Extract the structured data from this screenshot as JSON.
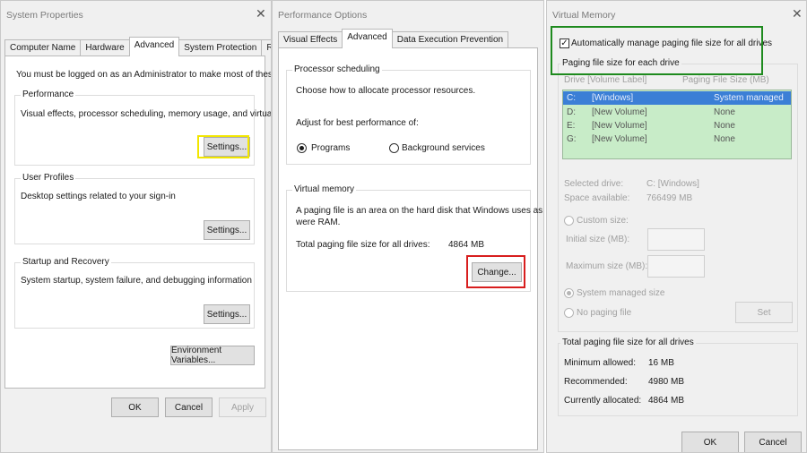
{
  "system_properties": {
    "title": "System Properties",
    "close_glyph": "✕",
    "tabs": [
      "Computer Name",
      "Hardware",
      "Advanced",
      "System Protection",
      "Remote"
    ],
    "admin_note": "You must be logged on as an Administrator to make most of these changes.",
    "performance": {
      "title": "Performance",
      "desc": "Visual effects, processor scheduling, memory usage, and virtual memory",
      "button": "Settings..."
    },
    "user_profiles": {
      "title": "User Profiles",
      "desc": "Desktop settings related to your sign-in",
      "button": "Settings..."
    },
    "startup": {
      "title": "Startup and Recovery",
      "desc": "System startup, system failure, and debugging information",
      "button": "Settings..."
    },
    "env_button": "Environment Variables...",
    "ok": "OK",
    "cancel": "Cancel",
    "apply": "Apply"
  },
  "performance_options": {
    "title": "Performance Options",
    "tabs": [
      "Visual Effects",
      "Advanced",
      "Data Execution Prevention"
    ],
    "processor": {
      "title": "Processor scheduling",
      "desc": "Choose how to allocate processor resources.",
      "adjust": "Adjust for best performance of:",
      "programs": "Programs",
      "background": "Background services",
      "selected": "programs"
    },
    "virtual_memory": {
      "title": "Virtual memory",
      "desc_line1": "A paging file is an area on the hard disk that Windows uses as if it",
      "desc_line2": "were RAM.",
      "total_label": "Total paging file size for all drives:",
      "total_value": "4864 MB",
      "change_button": "Change..."
    }
  },
  "virtual_memory": {
    "title": "Virtual Memory",
    "close_glyph": "✕",
    "auto_manage": "Automatically manage paging file size for all drives",
    "auto_checked": true,
    "paging_title": "Paging file size for each drive",
    "col_drive": "Drive  [Volume Label]",
    "col_size": "Paging File Size (MB)",
    "drives": [
      {
        "drive": "C:",
        "label": "[Windows]",
        "size": "System managed"
      },
      {
        "drive": "D:",
        "label": "[New Volume]",
        "size": "None"
      },
      {
        "drive": "E:",
        "label": "[New Volume]",
        "size": "None"
      },
      {
        "drive": "G:",
        "label": "[New Volume]",
        "size": "None"
      }
    ],
    "selected_drive_label": "Selected drive:",
    "selected_drive_value": "C:  [Windows]",
    "space_label": "Space available:",
    "space_value": "766499 MB",
    "custom_size": "Custom size:",
    "initial_label": "Initial size (MB):",
    "max_label": "Maximum size (MB):",
    "system_managed": "System managed size",
    "no_paging": "No paging file",
    "set_button": "Set",
    "totals_title": "Total paging file size for all drives",
    "min_label": "Minimum allowed:",
    "min_value": "16 MB",
    "rec_label": "Recommended:",
    "rec_value": "4980 MB",
    "cur_label": "Currently allocated:",
    "cur_value": "4864 MB",
    "ok": "OK",
    "cancel": "Cancel"
  },
  "colors": {
    "highlight_yellow": "#f2e600",
    "highlight_red": "#d81e1e",
    "highlight_green": "#1e8a1e",
    "drive_list_fill": "#c8ecc8",
    "selected_row": "#3b7fd6"
  }
}
